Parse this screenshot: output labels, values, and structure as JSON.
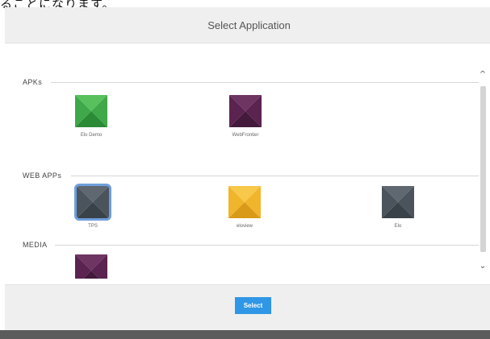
{
  "caption": "ることになります。",
  "dialog": {
    "title": "Select Application",
    "sections": [
      {
        "label": "APKs",
        "apps": [
          {
            "name": "Elo Demo",
            "icon": "green-app-icon",
            "color": "#3fa84a",
            "dark": "#2b8a35",
            "light": "#58c15e",
            "selected": false
          },
          {
            "name": "WebFrontier",
            "icon": "purple-app-icon",
            "color": "#5a2350",
            "dark": "#441a3c",
            "light": "#6e3563",
            "selected": false
          }
        ]
      },
      {
        "label": "WEB APPs",
        "apps": [
          {
            "name": "TPS",
            "icon": "slate-app-icon",
            "color": "#4b545d",
            "dark": "#3a4249",
            "light": "#5f6870",
            "selected": true
          },
          {
            "name": "eloview",
            "icon": "yellow-app-icon",
            "color": "#f1b52b",
            "dark": "#d99a19",
            "light": "#f7c849",
            "selected": false
          },
          {
            "name": "Elo",
            "icon": "slate-app-icon",
            "color": "#4b545d",
            "dark": "#3a4249",
            "light": "#5f6870",
            "selected": false
          }
        ]
      },
      {
        "label": "MEDIA",
        "apps": [
          {
            "name": "",
            "icon": "purple-app-icon",
            "color": "#5a2350",
            "dark": "#441a3c",
            "light": "#6e3563",
            "selected": false
          }
        ]
      }
    ],
    "scroll_up": "^",
    "scroll_down": "⌄",
    "select_label": "Select"
  }
}
